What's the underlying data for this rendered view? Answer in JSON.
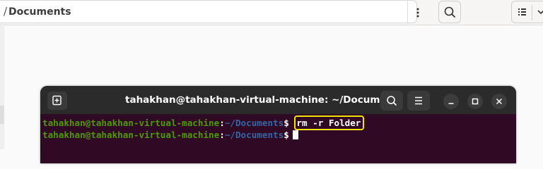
{
  "file_manager": {
    "path_label": "Documents",
    "path_separator": "/",
    "path_menu_icon": "kebab-menu-icon",
    "search_icon": "search-icon",
    "view_icon": "list-view-icon",
    "view_options_icon": "chevron-down-icon"
  },
  "terminal": {
    "title": "tahakhan@tahakhan-virtual-machine: ~/Documents",
    "buttons": {
      "new_tab_icon": "new-tab-icon",
      "search_icon": "search-icon",
      "menu_icon": "hamburger-menu-icon",
      "minimize_icon": "minimize-icon",
      "maximize_icon": "maximize-icon",
      "close_icon": "close-icon"
    },
    "prompt": {
      "user_host": "tahakhan@tahakhan-virtual-machine",
      "colon": ":",
      "path": "~/Documents",
      "symbol": "$"
    },
    "lines": [
      {
        "command": "rm -r Folder",
        "highlighted": true
      },
      {
        "command": "",
        "cursor": true
      }
    ],
    "colors": {
      "background": "#300a24",
      "header": "#2b2b2b",
      "user_host": "#4e9a06",
      "path": "#3465a4",
      "highlight": "#f0e400"
    }
  }
}
